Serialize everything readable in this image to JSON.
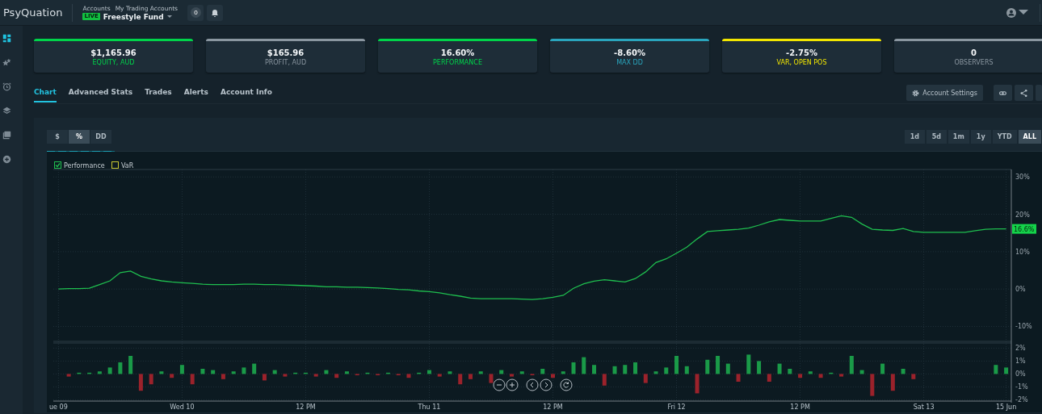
{
  "top_bar": {
    "logo": "PsyQuation",
    "breadcrumb": [
      "Accounts",
      "My Trading Accounts"
    ],
    "account": {
      "badge": "LIVE",
      "name": "Freestyle Fund"
    },
    "counter": "0"
  },
  "sidebar": {
    "items": [
      {
        "kind": "dashboard",
        "selected": true
      },
      {
        "kind": "stars",
        "selected": false
      },
      {
        "kind": "alarm",
        "selected": false
      },
      {
        "kind": "layers",
        "selected": false
      },
      {
        "kind": "library",
        "selected": false
      },
      {
        "kind": "add",
        "selected": false
      }
    ]
  },
  "stats": [
    {
      "value": "$1,165.96",
      "label": "EQUITY, AUD",
      "color": "#00d34a"
    },
    {
      "value": "$165.96",
      "label": "PROFIT, AUD",
      "color": "#8a96a0"
    },
    {
      "value": "16.60%",
      "label": "PERFORMANCE",
      "color": "#00d34a"
    },
    {
      "value": "-8.60%",
      "label": "MAX DD",
      "color": "#2aa5bd"
    },
    {
      "value": "-2.75%",
      "label": "VAR, OPEN POS",
      "color": "#f2e600"
    },
    {
      "value": "0",
      "label": "OBSERVERS",
      "color": "#8a96a0"
    }
  ],
  "tabs": [
    {
      "label": "Chart",
      "selected": true
    },
    {
      "label": "Advanced Stats",
      "selected": false
    },
    {
      "label": "Trades",
      "selected": false
    },
    {
      "label": "Alerts",
      "selected": false
    },
    {
      "label": "Account Info",
      "selected": false
    }
  ],
  "toolbar": {
    "settings_label": "Account Settings"
  },
  "chart": {
    "modes": [
      {
        "label": "$",
        "selected": false
      },
      {
        "label": "%",
        "selected": true
      },
      {
        "label": "DD",
        "selected": false
      }
    ],
    "ranges": [
      {
        "label": "1d",
        "selected": false
      },
      {
        "label": "5d",
        "selected": false
      },
      {
        "label": "1m",
        "selected": false
      },
      {
        "label": "1y",
        "selected": false
      },
      {
        "label": "YTD",
        "selected": false
      },
      {
        "label": "ALL",
        "selected": true
      }
    ],
    "performance_checked": true,
    "var_legend": {
      "label": "VaR",
      "checked": false,
      "color": "#c8c832"
    },
    "price_tag": "16.6%",
    "performance_pane": {
      "chart_data": {
        "type": "line",
        "grid": true,
        "ylim": [
          -14,
          32
        ],
        "yticks": [
          {
            "value": 30,
            "label": "30%"
          },
          {
            "value": 20,
            "label": "20%"
          },
          {
            "value": 10,
            "label": "10%"
          },
          {
            "value": 0,
            "label": "0%"
          },
          {
            "value": -10,
            "label": "-10%"
          }
        ],
        "series": [
          {
            "name": "Performance",
            "color": "#1fbf4f",
            "values": [
              0,
              0.1,
              0.1,
              0.2,
              1.2,
              2.2,
              4.4,
              4.8,
              3.4,
              2.7,
              2.2,
              1.9,
              1.7,
              1.5,
              1.3,
              1.2,
              1.2,
              1.2,
              1.3,
              1.3,
              1.2,
              1.2,
              1.1,
              1.0,
              0.9,
              0.8,
              0.6,
              0.6,
              0.5,
              0.5,
              0.4,
              0.3,
              0.1,
              -0.1,
              -0.2,
              -0.5,
              -0.7,
              -1.0,
              -1.5,
              -1.9,
              -2.4,
              -2.6,
              -2.6,
              -2.6,
              -2.6,
              -2.7,
              -2.8,
              -2.6,
              -2.2,
              -1.7,
              0.2,
              1.4,
              2.1,
              2.5,
              2.2,
              1.9,
              2.8,
              4.6,
              7.1,
              8.1,
              9.6,
              11.2,
              13.4,
              15.4,
              15.6,
              15.8,
              16.0,
              16.3,
              17.1,
              18.0,
              18.6,
              18.4,
              18.2,
              18.2,
              18.2,
              18.9,
              19.6,
              19.2,
              17.4,
              16.0,
              15.8,
              15.7,
              16.2,
              15.4,
              15.2,
              15.2,
              15.2,
              15.2,
              15.2,
              15.6,
              16.0,
              16.1,
              16.1
            ]
          }
        ]
      }
    },
    "returns_pane": {
      "chart_data": {
        "type": "bar",
        "grid": true,
        "ylim": [
          -2.1,
          2.4
        ],
        "categories": [
          "ue 09",
          null,
          null,
          null,
          null,
          null,
          null,
          null,
          null,
          null,
          null,
          null,
          "Wed 10",
          null,
          null,
          null,
          null,
          null,
          null,
          null,
          null,
          null,
          null,
          null,
          "12 PM",
          null,
          null,
          null,
          null,
          null,
          null,
          null,
          null,
          null,
          null,
          null,
          "Thu 11",
          null,
          null,
          null,
          null,
          null,
          null,
          null,
          null,
          null,
          null,
          null,
          "12 PM",
          null,
          null,
          null,
          null,
          null,
          null,
          null,
          null,
          null,
          null,
          null,
          "Fri 12",
          null,
          null,
          null,
          null,
          null,
          null,
          null,
          null,
          null,
          null,
          null,
          "12 PM",
          null,
          null,
          null,
          null,
          null,
          null,
          null,
          null,
          null,
          null,
          null,
          "Sat 13",
          null,
          null,
          null,
          null,
          null,
          null,
          null,
          "15 Jun"
        ],
        "yticks": [
          {
            "value": 2,
            "label": "2%"
          },
          {
            "value": 1,
            "label": "1%"
          },
          {
            "value": 0,
            "label": "0%"
          },
          {
            "value": -1,
            "label": "-1%"
          },
          {
            "value": -2,
            "label": "-2%"
          }
        ],
        "series": [
          {
            "color": "#1a9a48",
            "values": [
              null,
              null,
              0.1,
              0.1,
              0.2,
              0.5,
              0.9,
              1.4,
              null,
              null,
              0.2,
              null,
              0.7,
              null,
              0.4,
              0.3,
              null,
              0.2,
              0.5,
              0.8,
              null,
              0.3,
              null,
              0.1,
              0.1,
              null,
              0.3,
              null,
              0.2,
              null,
              0.1,
              null,
              0.1,
              null,
              null,
              0.1,
              0.3,
              null,
              0.2,
              null,
              null,
              0.2,
              null,
              0.3,
              null,
              0.2,
              null,
              0.4,
              null,
              0.2,
              0.9,
              1.3,
              0.7,
              null,
              0.6,
              0.7,
              0.9,
              null,
              0.2,
              0.5,
              1.4,
              0.6,
              null,
              1.1,
              1.4,
              0.8,
              null,
              1.5,
              1,
              null,
              0.8,
              0.4,
              null,
              0.2,
              null,
              0.1,
              null,
              1.4,
              0.3,
              null,
              0.8,
              null,
              0.4,
              null,
              null,
              null,
              null,
              null,
              null,
              null,
              null,
              0.7,
              0.5
            ]
          },
          {
            "color": "#9b222b",
            "values": [
              null,
              -0.2,
              null,
              null,
              null,
              null,
              null,
              null,
              -1.3,
              -0.8,
              null,
              -0.3,
              null,
              -0.8,
              null,
              null,
              -0.4,
              null,
              null,
              null,
              -0.5,
              null,
              -0.2,
              null,
              null,
              -0.2,
              null,
              -0.3,
              null,
              -0.1,
              null,
              -0.1,
              null,
              -0.1,
              -0.3,
              null,
              null,
              -0.2,
              null,
              -0.8,
              -0.4,
              null,
              -0.7,
              null,
              -0.2,
              null,
              -0.1,
              null,
              -0.3,
              null,
              null,
              null,
              null,
              -0.9,
              null,
              null,
              null,
              -0.7,
              null,
              null,
              null,
              null,
              -1.5,
              null,
              null,
              null,
              -0.6,
              null,
              null,
              -0.6,
              null,
              null,
              -0.3,
              null,
              -0.3,
              null,
              -0.2,
              null,
              null,
              -1.7,
              null,
              -1.3,
              null,
              -0.4,
              null,
              null,
              null,
              null,
              null,
              null,
              null,
              null,
              null
            ]
          }
        ]
      }
    }
  }
}
